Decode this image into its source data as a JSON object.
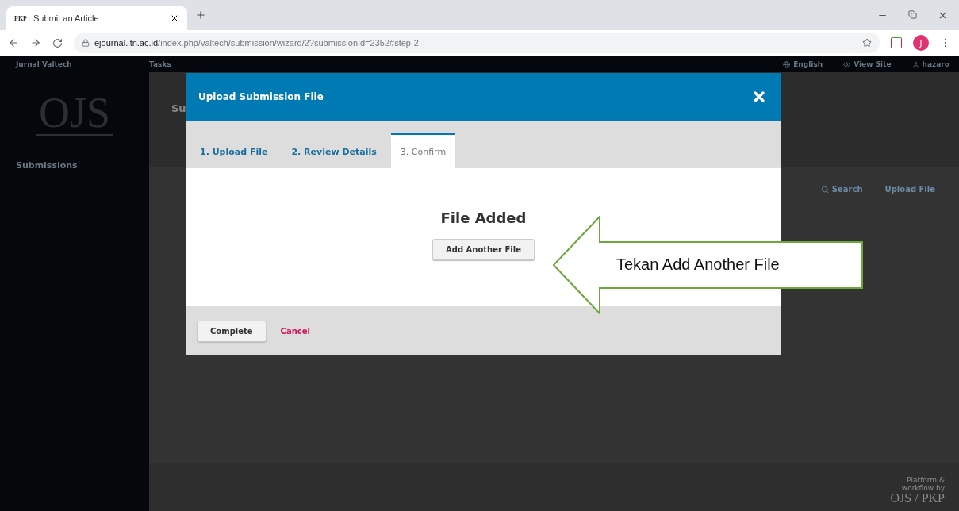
{
  "browser": {
    "tab_title": "Submit an Article",
    "tab_favicon": "PKP",
    "url_host": "ejournal.itn.ac.id",
    "url_path": "/index.php/valtech/submission/wizard/2?submissionId=2352#step-2",
    "profile_initial": "J"
  },
  "header": {
    "site": "Jurnal Valtech",
    "tasks": "Tasks",
    "links": [
      {
        "kind": "language",
        "label": "English"
      },
      {
        "kind": "view",
        "label": "View Site"
      },
      {
        "kind": "user",
        "label": "hazaro"
      }
    ]
  },
  "sidebar": {
    "logo": "OJS",
    "items": [
      {
        "label": "Submissions"
      }
    ]
  },
  "main": {
    "title_fragment": "Su",
    "actions": [
      {
        "kind": "search",
        "label": "Search"
      },
      {
        "kind": "upload",
        "label": "Upload File"
      }
    ]
  },
  "footer": {
    "line_1": "Platform &",
    "line_2": "workflow by",
    "brand": "OJS / PKP"
  },
  "modal": {
    "title": "Upload Submission File",
    "tabs": [
      {
        "label": "1. Upload File",
        "selected": false
      },
      {
        "label": "2. Review Details",
        "selected": false
      },
      {
        "label": "3. Confirm",
        "selected": true
      }
    ],
    "heading": "File Added",
    "add_button": "Add Another File",
    "complete_button": "Complete",
    "cancel_link": "Cancel"
  },
  "callout": {
    "text": "Tekan Add Another File"
  }
}
